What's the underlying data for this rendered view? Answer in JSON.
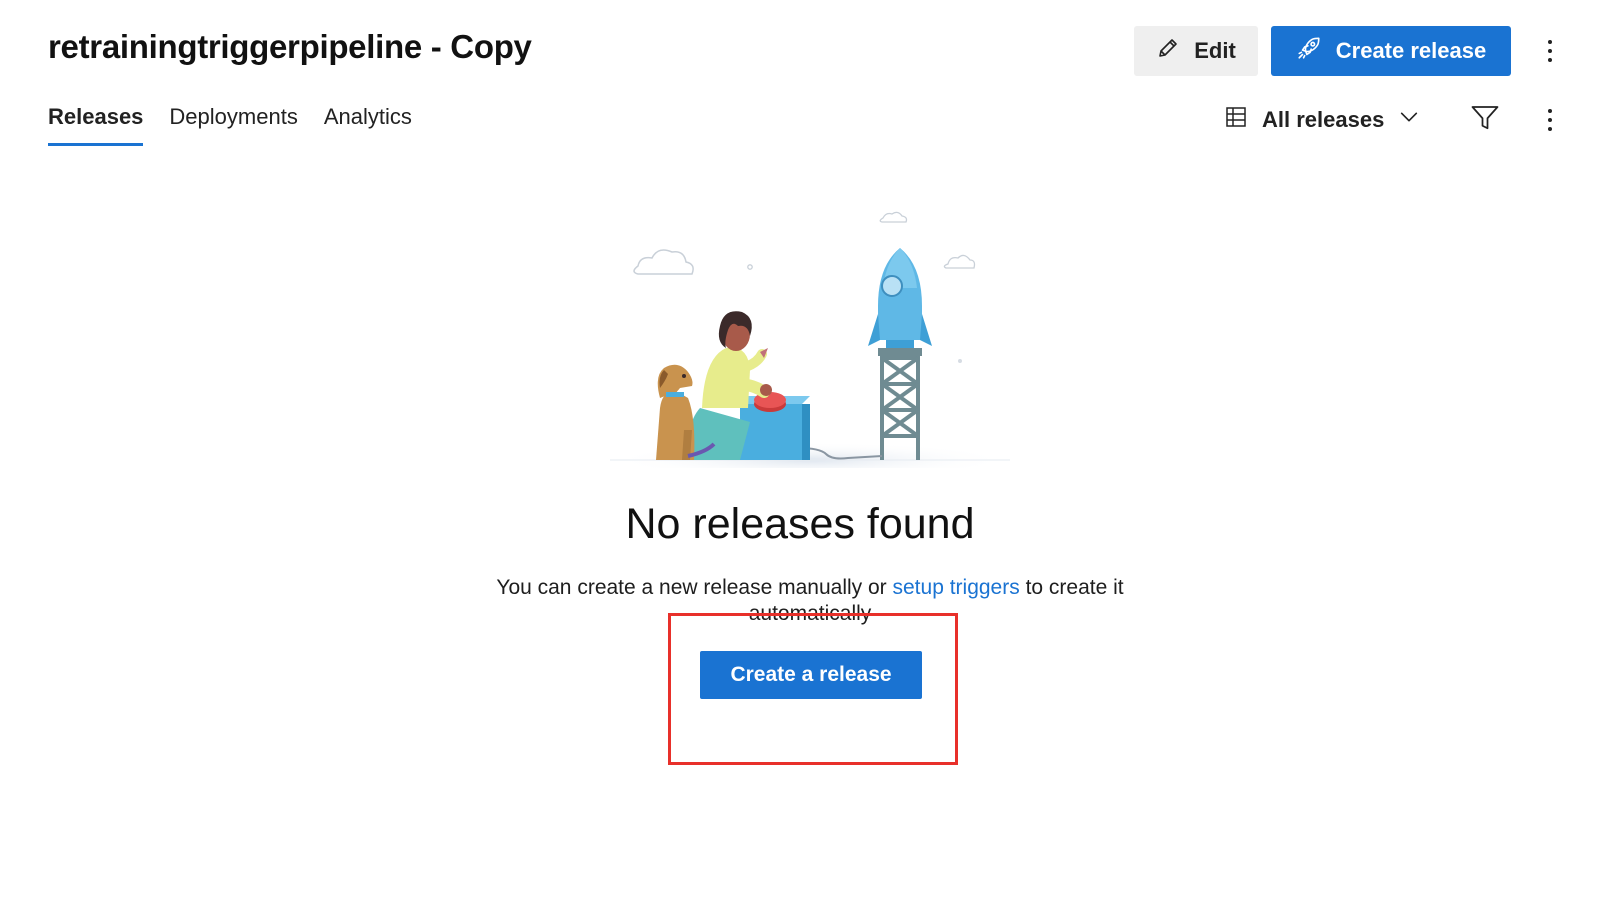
{
  "header": {
    "title": "retrainingtriggerpipeline - Copy",
    "edit_label": "Edit",
    "create_release_label": "Create release"
  },
  "tabs": [
    {
      "label": "Releases",
      "active": true
    },
    {
      "label": "Deployments",
      "active": false
    },
    {
      "label": "Analytics",
      "active": false
    }
  ],
  "toolbar": {
    "view_label": "All releases"
  },
  "empty_state": {
    "title": "No releases found",
    "desc_before": "You can create a new release manually or ",
    "desc_link": "setup triggers",
    "desc_after": " to create it automatically",
    "button_label": "Create a release"
  },
  "icons": {
    "edit": "pencil-icon",
    "create": "rocket-icon",
    "view": "table-icon",
    "dropdown": "chevron-down-icon",
    "filter": "filter-icon",
    "more": "more-vertical-icon"
  },
  "colors": {
    "accent": "#1a73d2",
    "highlight": "#e8302a"
  }
}
